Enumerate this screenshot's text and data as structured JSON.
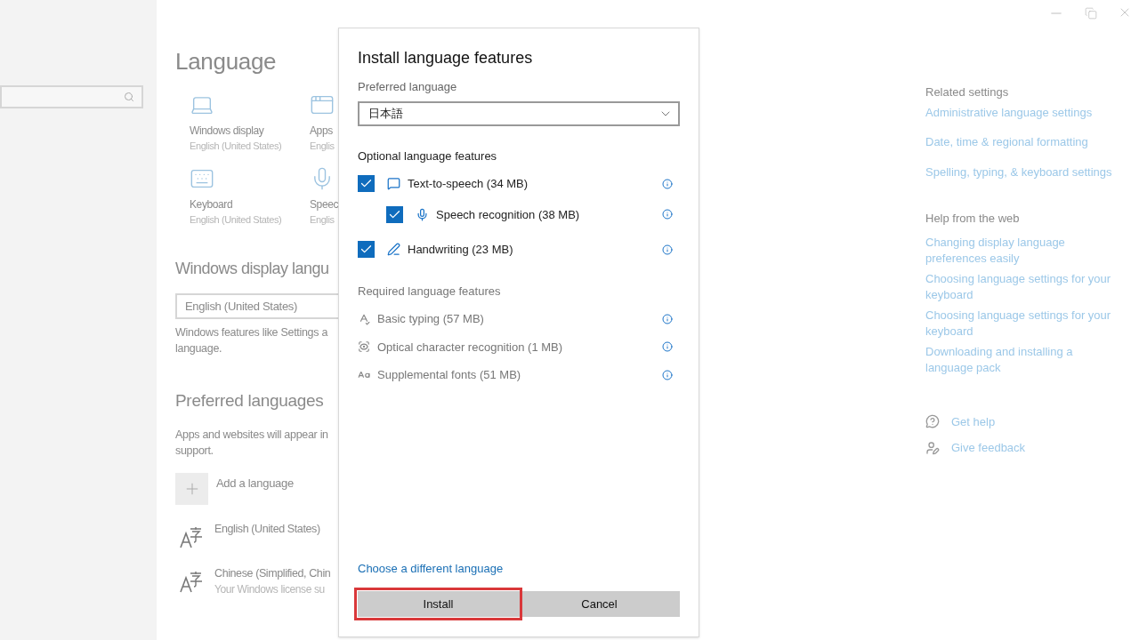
{
  "page": {
    "title": "Language",
    "tiles": [
      {
        "label": "Windows display",
        "sub": "English (United States)"
      },
      {
        "label": "Apps",
        "sub": "Englis"
      },
      {
        "label": "Keyboard",
        "sub": "English (United States)"
      },
      {
        "label": "Speec",
        "sub": "Englis"
      }
    ],
    "display_language": {
      "heading": "Windows display langu",
      "value": "English (United States)",
      "desc_lines": [
        "Windows features like Settings a",
        "language."
      ]
    },
    "preferred": {
      "heading": "Preferred languages",
      "desc_lines": [
        "Apps and websites will appear in",
        "support."
      ],
      "add_label": "Add a language",
      "languages": [
        {
          "name": "English (United States)"
        },
        {
          "name": "Chinese (Simplified, Chin",
          "sub": "Your Windows license su"
        }
      ]
    }
  },
  "dialog": {
    "title": "Install language features",
    "preferred_label": "Preferred language",
    "preferred_value": "日本語",
    "optional_heading": "Optional language features",
    "optional": [
      {
        "label": "Text-to-speech (34 MB)",
        "checked": true,
        "children": [
          {
            "label": "Speech recognition (38 MB)",
            "checked": true
          }
        ]
      },
      {
        "label": "Handwriting (23 MB)",
        "checked": true
      }
    ],
    "required_heading": "Required language features",
    "required": [
      {
        "label": "Basic typing (57 MB)"
      },
      {
        "label": "Optical character recognition (1 MB)"
      },
      {
        "label": "Supplemental fonts (51 MB)"
      }
    ],
    "link": "Choose a different language",
    "buttons": [
      {
        "label": "Install",
        "highlighted": true
      },
      {
        "label": "Cancel",
        "highlighted": false
      }
    ]
  },
  "related": {
    "heading": "Related settings",
    "links": [
      "Administrative language settings",
      "Date, time & regional formatting",
      "Spelling, typing, & keyboard settings"
    ]
  },
  "help": {
    "heading": "Help from the web",
    "links": [
      [
        "Changing display language",
        "preferences easily"
      ],
      [
        "Choosing language settings for your",
        "keyboard"
      ],
      [
        "Choosing language settings for your",
        "keyboard"
      ],
      [
        "Downloading and installing a",
        "language pack"
      ]
    ]
  },
  "support": [
    "Get help",
    "Give feedback"
  ]
}
